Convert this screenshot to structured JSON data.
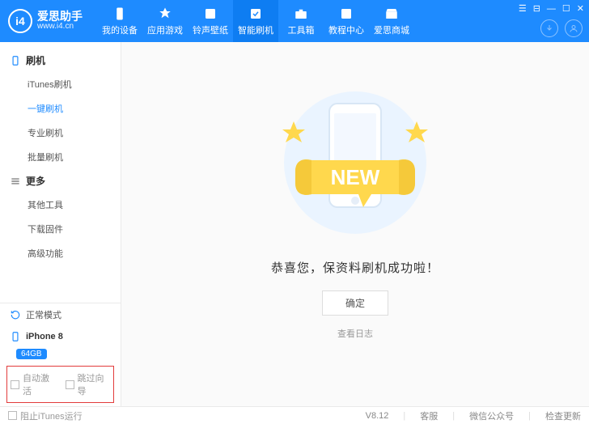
{
  "app": {
    "logo_text": "i4",
    "brand_cn": "爱思助手",
    "brand_url": "www.i4.cn"
  },
  "nav": [
    {
      "label": "我的设备"
    },
    {
      "label": "应用游戏"
    },
    {
      "label": "铃声壁纸"
    },
    {
      "label": "智能刷机"
    },
    {
      "label": "工具箱"
    },
    {
      "label": "教程中心"
    },
    {
      "label": "爱思商城"
    }
  ],
  "sidebar": {
    "group1_title": "刷机",
    "group1_items": [
      "iTunes刷机",
      "一键刷机",
      "专业刷机",
      "批量刷机"
    ],
    "group2_title": "更多",
    "group2_items": [
      "其他工具",
      "下载固件",
      "高级功能"
    ],
    "mode_label": "正常模式",
    "device_label": "iPhone 8",
    "device_badge": "64GB",
    "opt_auto_activate": "自动激活",
    "opt_skip_wizard": "跳过向导"
  },
  "content": {
    "message": "恭喜您，保资料刷机成功啦！",
    "ok_label": "确定",
    "log_label": "查看日志",
    "new_text": "NEW"
  },
  "status": {
    "block_itunes": "阻止iTunes运行",
    "version": "V8.12",
    "service": "客服",
    "wechat": "微信公众号",
    "update": "检查更新"
  }
}
